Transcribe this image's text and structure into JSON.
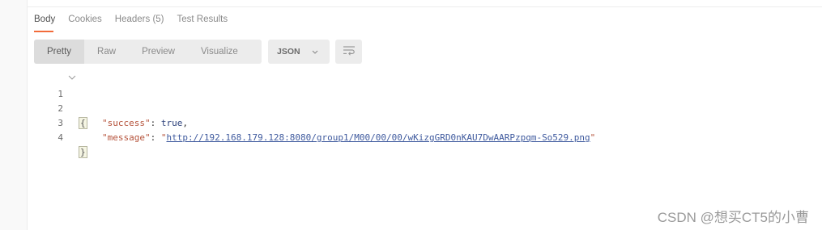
{
  "tabs": [
    {
      "label": "Body",
      "active": true
    },
    {
      "label": "Cookies",
      "active": false
    },
    {
      "label": "Headers (5)",
      "active": false
    },
    {
      "label": "Test Results",
      "active": false
    }
  ],
  "view_modes": [
    "Pretty",
    "Raw",
    "Preview",
    "Visualize"
  ],
  "active_view": "Pretty",
  "format_select": {
    "value": "JSON",
    "icon": "chevron-down-icon"
  },
  "wrap_button": {
    "icon": "wrap-lines-icon"
  },
  "code": {
    "line_numbers": [
      "1",
      "2",
      "3",
      "4"
    ],
    "open_brace": "{",
    "close_brace": "}",
    "success_key": "\"success\"",
    "success_value": "true",
    "message_key": "\"message\"",
    "message_url": "http://192.168.179.128:8080/group1/M00/00/00/wKizgGRD0nKAU7DwAARPzpqm-So529.png"
  },
  "watermark": "CSDN @想买CT5的小曹",
  "colors": {
    "active_tab_underline": "#f26b3a",
    "json_key": "#b5523a",
    "json_bool": "#2a3f7a",
    "url": "#3f5a9e"
  }
}
